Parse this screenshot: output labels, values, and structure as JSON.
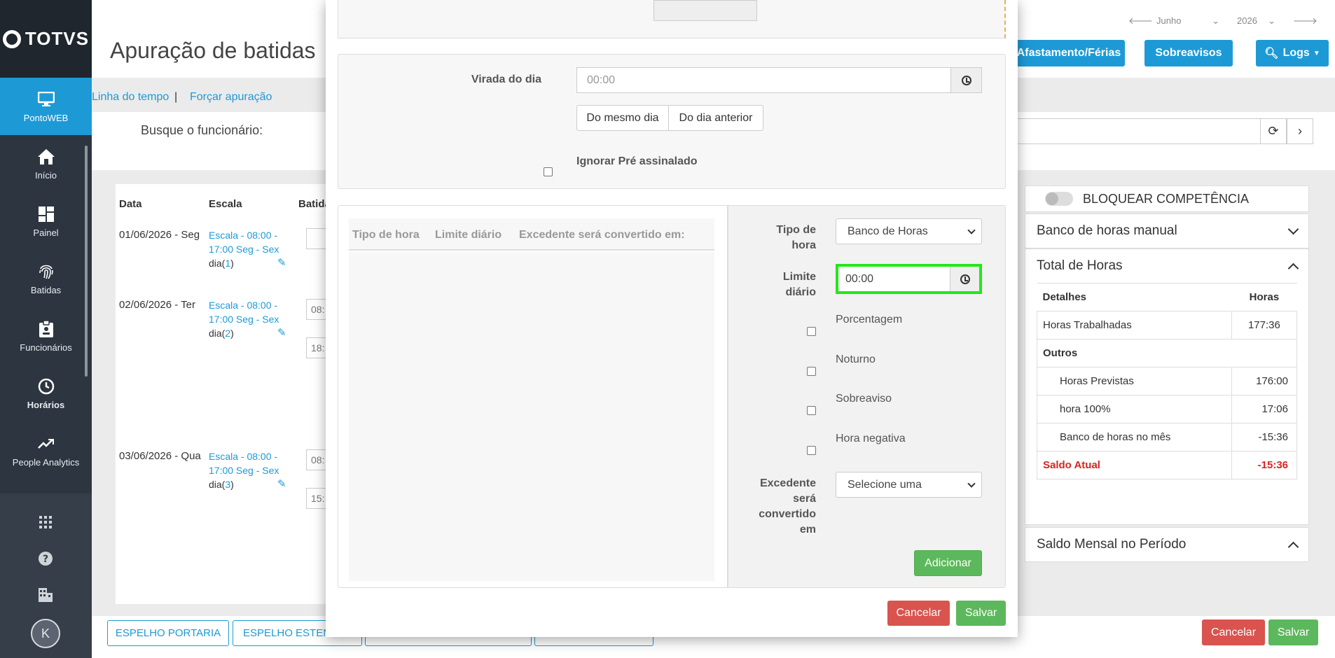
{
  "sidebar": {
    "logo": "TOTVS",
    "items": [
      {
        "label": "PontoWEB",
        "icon": "monitor-icon"
      },
      {
        "label": "Início",
        "icon": "home-icon"
      },
      {
        "label": "Painel",
        "icon": "dashboard-icon"
      },
      {
        "label": "Batidas",
        "icon": "fingerprint-icon"
      },
      {
        "label": "Funcionários",
        "icon": "badge-icon"
      },
      {
        "label": "Horários",
        "icon": "clock-icon"
      },
      {
        "label": "People Analytics",
        "icon": "trend-icon"
      }
    ],
    "avatar": "K"
  },
  "page": {
    "title": "Apuração de batidas",
    "month": "Junho",
    "year": "2026",
    "buttons": {
      "afastamento": "Afastamento/Férias",
      "sobreavisos": "Sobreavisos",
      "logs": "Logs"
    },
    "links": {
      "timeline": "Linha do tempo",
      "separator": "|",
      "force": "Forçar apuração"
    },
    "search_label": "Busque o funcionário:"
  },
  "table": {
    "headers": {
      "date": "Data",
      "scale": "Escala",
      "punches": "Batidas"
    },
    "rows": [
      {
        "date": "01/06/2026 - Seg",
        "scale1": "Escala - 08:00 -",
        "scale2": "17:00 Seg - Sex",
        "day_prefix": "dia(",
        "day_num": "1",
        "day_suffix": ")",
        "in1": "",
        "in2": ""
      },
      {
        "date": "02/06/2026 - Ter",
        "scale1": "Escala - 08:00 -",
        "scale2": "17:00 Seg - Sex",
        "day_prefix": "dia(",
        "day_num": "2",
        "day_suffix": ")",
        "in1": "08:",
        "in2": "18:"
      },
      {
        "date": "03/06/2026 - Qua",
        "scale1": "Escala - 08:00 -",
        "scale2": "17:00 Seg - Sex",
        "day_prefix": "dia(",
        "day_num": "3",
        "day_suffix": ")",
        "in1": "08:",
        "in2": "15:"
      }
    ]
  },
  "right": {
    "block": "BLOQUEAR COMPETÊNCIA",
    "manual": "Banco de horas manual",
    "total": "Total de Horas",
    "details_header": "Detalhes",
    "hours_header": "Horas",
    "rows": [
      {
        "label": "Horas Trabalhadas",
        "value": "177:36"
      },
      {
        "label": "Outros",
        "value": ""
      },
      {
        "label": "Horas Previstas",
        "value": "176:00"
      },
      {
        "label": "hora 100%",
        "value": "17:06"
      },
      {
        "label": "Banco de horas no mês",
        "value": "-15:36"
      }
    ],
    "saldo_label": "Saldo Atual",
    "saldo_value": "-15:36",
    "monthly": "Saldo Mensal no Período",
    "saldo_color": "#d9251d"
  },
  "bottom": {
    "espelho_portaria": "ESPELHO PORTARIA",
    "espelho_estendido": "ESPELHO ESTENDIDO",
    "cancel": "Cancelar",
    "save": "Salvar"
  },
  "modal": {
    "virada_label": "Virada do dia",
    "virada_value": "00:00",
    "same_day": "Do mesmo dia",
    "prev_day": "Do dia anterior",
    "ignore_label": "Ignorar Pré assinalado",
    "grid_headers": {
      "type": "Tipo de hora",
      "limit": "Limite diário",
      "excess": "Excedente será convertido em:"
    },
    "form": {
      "type_label_1": "Tipo de",
      "type_label_2": "hora",
      "type_value": "Banco de Horas",
      "limit_label_1": "Limite",
      "limit_label_2": "diário",
      "limit_value": "00:00",
      "percent": "Porcentagem",
      "night": "Noturno",
      "standby": "Sobreaviso",
      "negative": "Hora negativa",
      "excess_l1": "Excedente",
      "excess_l2": "será",
      "excess_l3": "convertido",
      "excess_l4": "em",
      "excess_value": "Selecione uma",
      "add": "Adicionar"
    },
    "cancel": "Cancelar",
    "save": "Salvar",
    "highlight_color": "#22e81a"
  }
}
